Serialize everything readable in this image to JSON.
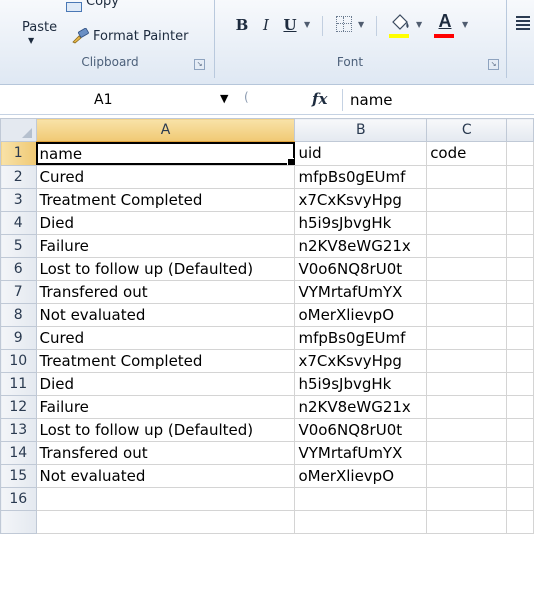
{
  "ribbon": {
    "clipboard": {
      "paste_label": "Paste",
      "copy_label": "Copy",
      "format_painter_label": "Format Painter",
      "group_label": "Clipboard"
    },
    "font": {
      "bold_label": "B",
      "italic_label": "I",
      "underline_label": "U",
      "font_color_label": "A",
      "fill_color": "#ffff00",
      "font_color": "#ff0000",
      "group_label": "Font"
    }
  },
  "formula_bar": {
    "name_box": "A1",
    "fx_label": "fx",
    "value": "name"
  },
  "sheet": {
    "columns": [
      "A",
      "B",
      "C"
    ],
    "rows": [
      {
        "num": "1",
        "a": "name",
        "b": "uid",
        "c": "code"
      },
      {
        "num": "2",
        "a": "Cured",
        "b": "mfpBs0gEUmf",
        "c": ""
      },
      {
        "num": "3",
        "a": "Treatment Completed",
        "b": "x7CxKsvyHpg",
        "c": ""
      },
      {
        "num": "4",
        "a": "Died",
        "b": "h5i9sJbvgHk",
        "c": ""
      },
      {
        "num": "5",
        "a": "Failure",
        "b": "n2KV8eWG21x",
        "c": ""
      },
      {
        "num": "6",
        "a": "Lost to follow up (Defaulted)",
        "b": "V0o6NQ8rU0t",
        "c": ""
      },
      {
        "num": "7",
        "a": "Transfered out",
        "b": "VYMrtafUmYX",
        "c": ""
      },
      {
        "num": "8",
        "a": "Not evaluated",
        "b": "oMerXlievpO",
        "c": ""
      },
      {
        "num": "9",
        "a": "Cured",
        "b": "mfpBs0gEUmf",
        "c": ""
      },
      {
        "num": "10",
        "a": "Treatment Completed",
        "b": "x7CxKsvyHpg",
        "c": ""
      },
      {
        "num": "11",
        "a": "Died",
        "b": "h5i9sJbvgHk",
        "c": ""
      },
      {
        "num": "12",
        "a": "Failure",
        "b": "n2KV8eWG21x",
        "c": ""
      },
      {
        "num": "13",
        "a": "Lost to follow up (Defaulted)",
        "b": "V0o6NQ8rU0t",
        "c": ""
      },
      {
        "num": "14",
        "a": "Transfered out",
        "b": "VYMrtafUmYX",
        "c": ""
      },
      {
        "num": "15",
        "a": "Not evaluated",
        "b": "oMerXlievpO",
        "c": ""
      },
      {
        "num": "16",
        "a": "",
        "b": "",
        "c": ""
      },
      {
        "num": "",
        "a": "",
        "b": "",
        "c": ""
      }
    ]
  }
}
